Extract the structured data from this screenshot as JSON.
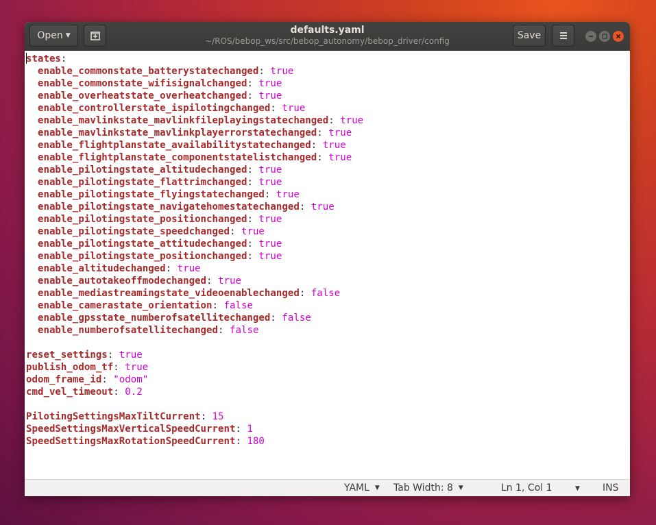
{
  "window": {
    "title": "defaults.yaml",
    "subtitle": "~/ROS/bebop_ws/src/bebop_autonomy/bebop_driver/config",
    "open_label": "Open",
    "save_label": "Save"
  },
  "editor": {
    "lines": [
      {
        "key": "states",
        "value": ""
      },
      {
        "key": "  enable_commonstate_batterystatechanged",
        "value": "true"
      },
      {
        "key": "  enable_commonstate_wifisignalchanged",
        "value": "true"
      },
      {
        "key": "  enable_overheatstate_overheatchanged",
        "value": "true"
      },
      {
        "key": "  enable_controllerstate_ispilotingchanged",
        "value": "true"
      },
      {
        "key": "  enable_mavlinkstate_mavlinkfileplayingstatechanged",
        "value": "true"
      },
      {
        "key": "  enable_mavlinkstate_mavlinkplayerrorstatechanged",
        "value": "true"
      },
      {
        "key": "  enable_flightplanstate_availabilitystatechanged",
        "value": "true"
      },
      {
        "key": "  enable_flightplanstate_componentstatelistchanged",
        "value": "true"
      },
      {
        "key": "  enable_pilotingstate_altitudechanged",
        "value": "true"
      },
      {
        "key": "  enable_pilotingstate_flattrimchanged",
        "value": "true"
      },
      {
        "key": "  enable_pilotingstate_flyingstatechanged",
        "value": "true"
      },
      {
        "key": "  enable_pilotingstate_navigatehomestatechanged",
        "value": "true"
      },
      {
        "key": "  enable_pilotingstate_positionchanged",
        "value": "true"
      },
      {
        "key": "  enable_pilotingstate_speedchanged",
        "value": "true"
      },
      {
        "key": "  enable_pilotingstate_attitudechanged",
        "value": "true"
      },
      {
        "key": "  enable_pilotingstate_positionchanged",
        "value": "true"
      },
      {
        "key": "  enable_altitudechanged",
        "value": "true"
      },
      {
        "key": "  enable_autotakeoffmodechanged",
        "value": "true"
      },
      {
        "key": "  enable_mediastreamingstate_videoenablechanged",
        "value": "false"
      },
      {
        "key": "  enable_camerastate_orientation",
        "value": "false"
      },
      {
        "key": "  enable_gpsstate_numberofsatellitechanged",
        "value": "false"
      },
      {
        "key": "  enable_numberofsatellitechanged",
        "value": "false"
      },
      {
        "key": "",
        "value": ""
      },
      {
        "key": "reset_settings",
        "value": "true"
      },
      {
        "key": "publish_odom_tf",
        "value": "true"
      },
      {
        "key": "odom_frame_id",
        "value": "\"odom\""
      },
      {
        "key": "cmd_vel_timeout",
        "value": "0.2"
      },
      {
        "key": "",
        "value": ""
      },
      {
        "key": "PilotingSettingsMaxTiltCurrent",
        "value": "15"
      },
      {
        "key": "SpeedSettingsMaxVerticalSpeedCurrent",
        "value": "1"
      },
      {
        "key": "SpeedSettingsMaxRotationSpeedCurrent",
        "value": "180"
      }
    ]
  },
  "statusbar": {
    "language": "YAML",
    "tab_width": "Tab Width: 8",
    "position": "Ln 1, Col 1",
    "mode": "INS"
  },
  "colors": {
    "key": "#a52a2a",
    "value": "#d200d2",
    "close_button": "#e8542a"
  },
  "icons": [
    "caret-down-icon",
    "new-tab-icon",
    "hamburger-menu-icon",
    "minimize-icon",
    "maximize-icon",
    "close-icon"
  ]
}
